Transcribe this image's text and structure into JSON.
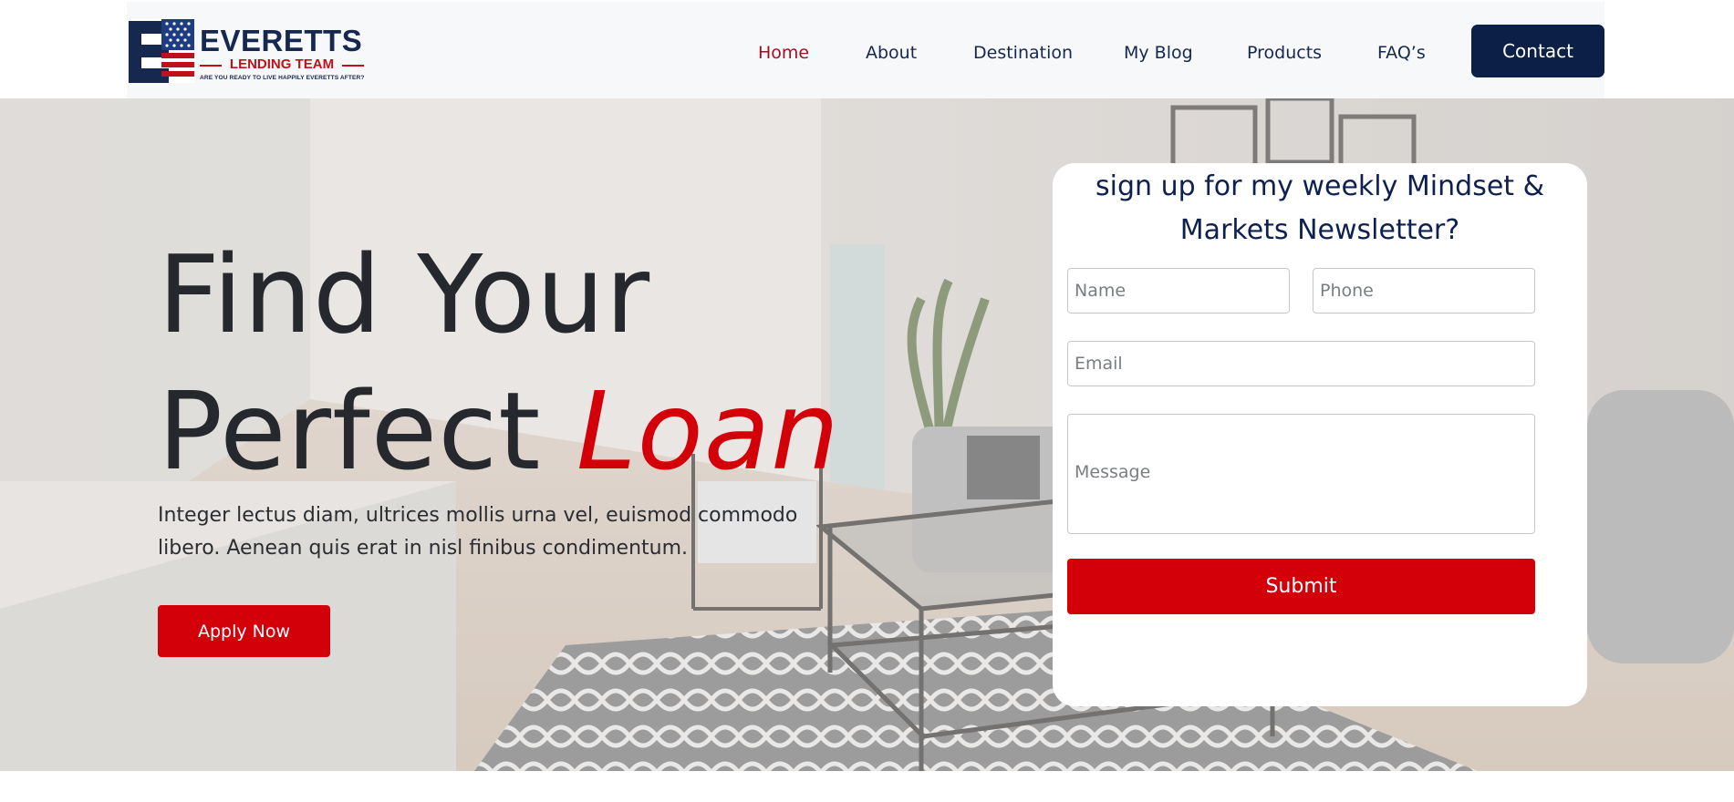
{
  "brand": {
    "name": "EVERETTS",
    "subtitle": "LENDING TEAM",
    "tagline": "ARE YOU READY TO LIVE HAPPILY EVERETTS AFTER?",
    "logo_icon": "flag-e-logo-icon"
  },
  "nav": {
    "items": [
      {
        "label": "Home",
        "active": true
      },
      {
        "label": "About"
      },
      {
        "label": "Destination"
      },
      {
        "label": "My Blog"
      },
      {
        "label": "Products"
      },
      {
        "label": "FAQ’s"
      }
    ],
    "contact_label": "Contact"
  },
  "hero": {
    "title_line1": "Find Your",
    "title_line2_plain": "Perfect ",
    "title_line2_accent": "Loan",
    "subtitle": "Integer lectus diam, ultrices mollis urna vel, euismod commodo libero. Aenean quis erat in nisl finibus condimentum.",
    "apply_label": "Apply Now",
    "background": "living-room-photo"
  },
  "form": {
    "title": "sign up for my weekly Mindset & Markets Newsletter?",
    "name_placeholder": "Name",
    "phone_placeholder": "Phone",
    "email_placeholder": "Email",
    "message_placeholder": "Message",
    "submit_label": "Submit"
  },
  "colors": {
    "navy": "#0c1f47",
    "accent_red": "#d3000a",
    "active_nav": "#9b1220"
  }
}
